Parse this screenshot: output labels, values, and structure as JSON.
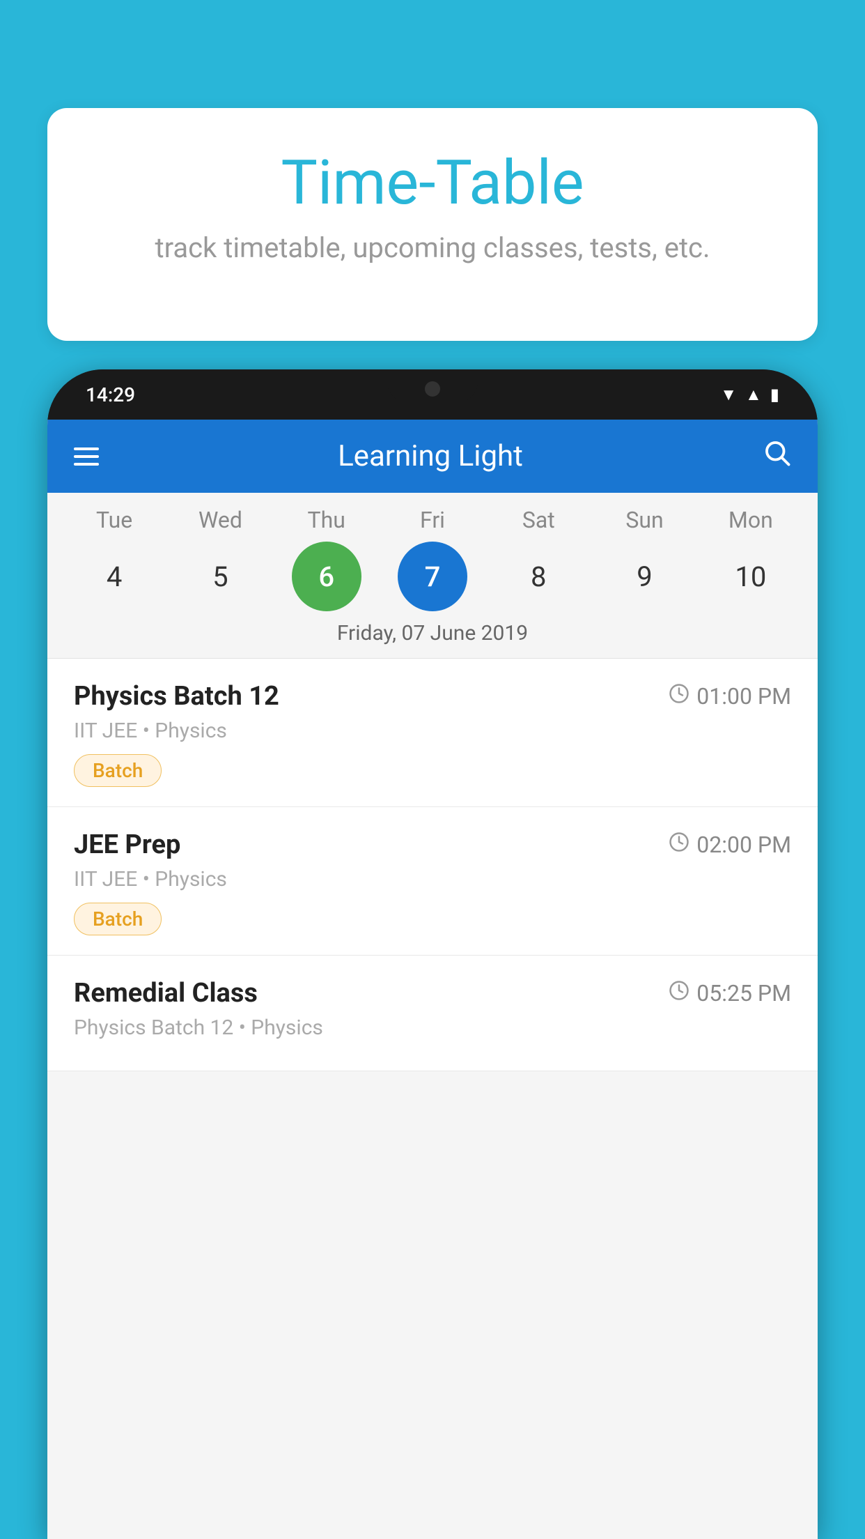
{
  "background_color": "#29b6d8",
  "bubble": {
    "title": "Time-Table",
    "subtitle": "track timetable, upcoming classes, tests, etc."
  },
  "phone": {
    "status_bar": {
      "time": "14:29"
    },
    "app_header": {
      "title": "Learning Light"
    },
    "calendar": {
      "days": [
        {
          "name": "Tue",
          "num": "4",
          "state": "normal"
        },
        {
          "name": "Wed",
          "num": "5",
          "state": "normal"
        },
        {
          "name": "Thu",
          "num": "6",
          "state": "today"
        },
        {
          "name": "Fri",
          "num": "7",
          "state": "selected"
        },
        {
          "name": "Sat",
          "num": "8",
          "state": "normal"
        },
        {
          "name": "Sun",
          "num": "9",
          "state": "normal"
        },
        {
          "name": "Mon",
          "num": "10",
          "state": "normal"
        }
      ],
      "selected_date_label": "Friday, 07 June 2019"
    },
    "schedule": [
      {
        "title": "Physics Batch 12",
        "time": "01:00 PM",
        "subtitle": "IIT JEE • Physics",
        "badge": "Batch"
      },
      {
        "title": "JEE Prep",
        "time": "02:00 PM",
        "subtitle": "IIT JEE • Physics",
        "badge": "Batch"
      },
      {
        "title": "Remedial Class",
        "time": "05:25 PM",
        "subtitle": "Physics Batch 12 • Physics",
        "badge": ""
      }
    ]
  }
}
